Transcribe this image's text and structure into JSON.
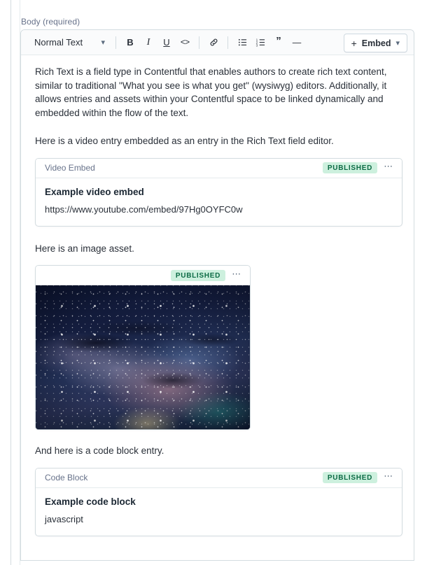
{
  "field": {
    "label": "Body (required)"
  },
  "toolbar": {
    "style_select": {
      "value": "Normal Text",
      "caret_icon": "chevron-down-icon"
    },
    "buttons": [
      {
        "name": "bold",
        "glyph": "B"
      },
      {
        "name": "italic",
        "glyph": "I"
      },
      {
        "name": "underline",
        "glyph": "U"
      },
      {
        "name": "code",
        "glyph": "<>"
      },
      {
        "name": "hyperlink",
        "glyph": "link-icon"
      },
      {
        "name": "unordered-list",
        "glyph": "bulleted-list-icon"
      },
      {
        "name": "ordered-list",
        "glyph": "numbered-list-icon"
      },
      {
        "name": "blockquote",
        "glyph": "”"
      },
      {
        "name": "horizontal-rule",
        "glyph": "—"
      }
    ],
    "embed": {
      "plus": "+",
      "label": "Embed",
      "caret_icon": "chevron-down-icon"
    }
  },
  "body": {
    "paragraph_1": "Rich Text is a field type in Contentful that enables authors to create rich text content, similar to traditional \"What you see is what you get\" (wysiwyg) editors. Additionally, it allows entries and assets within your Contentful space to be linked dynamically and embedded within the flow of the text.",
    "paragraph_2": "Here is a video entry embedded as an entry in the Rich Text field editor.",
    "paragraph_3": "Here is an image asset.",
    "paragraph_4": "And here is a code block entry."
  },
  "cards": {
    "video_embed": {
      "type": "Video Embed",
      "status": "PUBLISHED",
      "title": "Example video embed",
      "subtitle": "https://www.youtube.com/embed/97Hg0OYFC0w",
      "menu_icon": "ellipsis-icon"
    },
    "image_asset": {
      "type": "",
      "status": "PUBLISHED",
      "menu_icon": "ellipsis-icon",
      "alt": "Milky Way galaxy starfield"
    },
    "code_block": {
      "type": "Code Block",
      "status": "PUBLISHED",
      "title": "Example code block",
      "subtitle": "javascript",
      "menu_icon": "ellipsis-icon"
    }
  },
  "colors": {
    "badge_bg": "#cdf0de",
    "badge_text": "#0c6b45",
    "border": "#d3dce0",
    "text": "#2a3039",
    "muted": "#67728a",
    "toolbar_bg": "#fafbfc"
  }
}
